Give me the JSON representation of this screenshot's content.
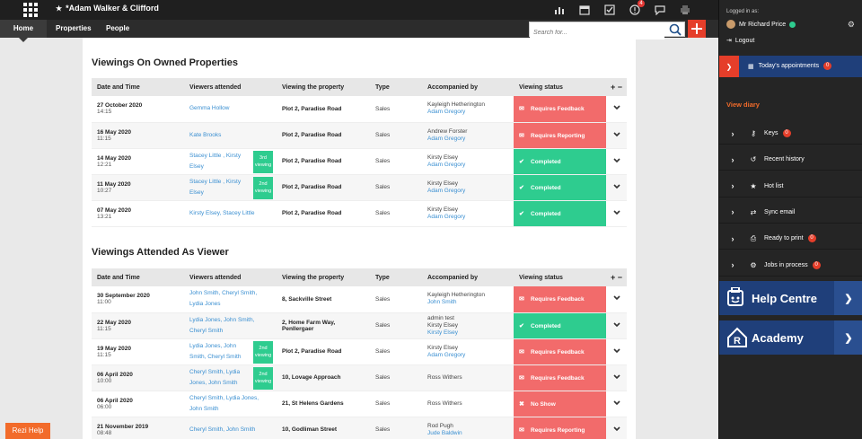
{
  "header": {
    "agency_name": "*Adam Walker & Clifford",
    "notification_count": "4"
  },
  "nav": {
    "home": "Home",
    "properties": "Properties",
    "people": "People"
  },
  "search": {
    "placeholder": "Search for..."
  },
  "owned": {
    "title": "Viewings On Owned Properties",
    "columns": [
      "Date and Time",
      "Viewers attended",
      "Viewing the property",
      "Type",
      "Accompanied by",
      "Viewing status",
      "+ −"
    ],
    "rows": [
      {
        "date": "27 October 2020",
        "time": "14:15",
        "viewers": "Gemma Hollow",
        "count": "",
        "property": "Plot 2, Paradise Road",
        "type": "Sales",
        "acc1": "Kayleigh Hetherington",
        "acc2": "Adam Gregory",
        "status": "Requires Feedback",
        "status_kind": "red"
      },
      {
        "date": "16 May 2020",
        "time": "11:15",
        "viewers": "Kate Brooks",
        "count": "",
        "property": "Plot 2, Paradise Road",
        "type": "Sales",
        "acc1": "Andrew Forster",
        "acc2": "Adam Gregory",
        "status": "Requires Reporting",
        "status_kind": "red"
      },
      {
        "date": "14 May 2020",
        "time": "12:21",
        "viewers": "Stacey Little , Kirsty Elsey",
        "count": "3rd viewing",
        "property": "Plot 2, Paradise Road",
        "type": "Sales",
        "acc1": "Kirsty Elsey",
        "acc2": "Adam Gregory",
        "status": "Completed",
        "status_kind": "green"
      },
      {
        "date": "11 May 2020",
        "time": "10:27",
        "viewers": "Stacey Little , Kirsty Elsey",
        "count": "2nd viewing",
        "property": "Plot 2, Paradise Road",
        "type": "Sales",
        "acc1": "Kirsty Elsey",
        "acc2": "Adam Gregory",
        "status": "Completed",
        "status_kind": "green"
      },
      {
        "date": "07 May 2020",
        "time": "13:21",
        "viewers": "Kirsty Elsey, Stacey Little",
        "count": "",
        "property": "Plot 2, Paradise Road",
        "type": "Sales",
        "acc1": "Kirsty Elsey",
        "acc2": "Adam Gregory",
        "status": "Completed",
        "status_kind": "green"
      }
    ]
  },
  "attended": {
    "title": "Viewings Attended As Viewer",
    "columns": [
      "Date and Time",
      "Viewers attended",
      "Viewing the property",
      "Type",
      "Accompanied by",
      "Viewing status",
      "+ −"
    ],
    "rows": [
      {
        "date": "30 September 2020",
        "time": "11:00",
        "viewers": "John Smith, Cheryl Smith, Lydia Jones",
        "count": "",
        "property": "8, Sackville Street",
        "type": "Sales",
        "acc1": "Kayleigh Hetherington",
        "acc2": "John Smith",
        "acc3": "",
        "status": "Requires Feedback",
        "status_kind": "red"
      },
      {
        "date": "22 May 2020",
        "time": "11:15",
        "viewers": "Lydia Jones, John Smith, Cheryl Smith",
        "count": "",
        "property": "2, Home Farm Way, Penllergaer",
        "type": "Sales",
        "acc1": "admin test",
        "acc2": "Kirsty Elsey",
        "acc3": "Kirsty Elsey",
        "status": "Completed",
        "status_kind": "green"
      },
      {
        "date": "19 May 2020",
        "time": "11:15",
        "viewers": "Lydia Jones, John Smith, Cheryl Smith",
        "count": "2nd viewing",
        "property": "Plot 2, Paradise Road",
        "type": "Sales",
        "acc1": "Kirsty Elsey",
        "acc2": "Adam Gregory",
        "acc3": "",
        "status": "Requires Feedback",
        "status_kind": "red"
      },
      {
        "date": "06 April 2020",
        "time": "10:00",
        "viewers": "Cheryl Smith, Lydia Jones, John Smith",
        "count": "2nd viewing",
        "property": "10, Lovage Approach",
        "type": "Sales",
        "acc1": "Ross Withers",
        "acc2": "",
        "acc3": "",
        "status": "Requires Feedback",
        "status_kind": "red"
      },
      {
        "date": "06 April 2020",
        "time": "06:00",
        "viewers": "Cheryl Smith, Lydia Jones, John Smith",
        "count": "",
        "property": "21, St Helens Gardens",
        "type": "Sales",
        "acc1": "Ross Withers",
        "acc2": "",
        "acc3": "",
        "status": "No Show",
        "status_kind": "red"
      },
      {
        "date": "21 November 2019",
        "time": "08:48",
        "viewers": "Cheryl Smith, John Smith",
        "count": "",
        "property": "10, Godliman Street",
        "type": "Sales",
        "acc1": "Rod Pugh",
        "acc2": "Jude Baldwin",
        "acc3": "",
        "status": "Requires Reporting",
        "status_kind": "red"
      }
    ]
  },
  "sidebar": {
    "logged_in_as": "Logged in as:",
    "user_name": "Mr Richard Price",
    "logout": "Logout",
    "today_label": "Today's appointments",
    "today_count": "0",
    "view_diary": "View diary",
    "items": [
      {
        "label": "Keys",
        "badge": "0",
        "icon": "key-icon"
      },
      {
        "label": "Recent history",
        "badge": "",
        "icon": "history-icon"
      },
      {
        "label": "Hot list",
        "badge": "",
        "icon": "star-icon"
      },
      {
        "label": "Sync email",
        "badge": "",
        "icon": "sync-icon"
      },
      {
        "label": "Ready to print",
        "badge": "0",
        "icon": "printer-icon"
      },
      {
        "label": "Jobs in process",
        "badge": "0",
        "icon": "gear-icon"
      }
    ],
    "help_centre": "Help Centre",
    "academy": "Academy"
  },
  "rezi_help": "Rezi Help",
  "colors": {
    "accent": "#e53e2a",
    "status_red": "#f26b6b",
    "status_green": "#2ecc8f",
    "sidebar_blue": "#1f3f7a"
  }
}
